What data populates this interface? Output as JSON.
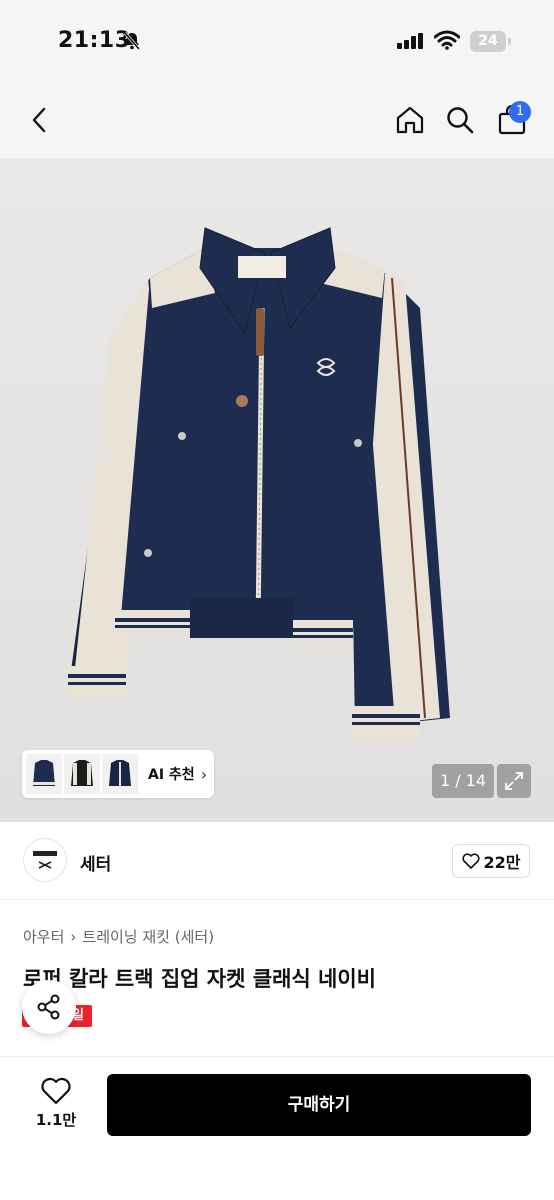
{
  "status_bar": {
    "time": "21:13",
    "battery": "24"
  },
  "nav": {
    "cart_badge": "1",
    "icons": [
      "back-icon",
      "home-icon",
      "search-icon",
      "cart-icon"
    ]
  },
  "gallery": {
    "image_desc_icon": "jacket-photo",
    "ai_reco_label": "AI 추천",
    "page_counter": "1 / 14"
  },
  "shop": {
    "name": "세터",
    "like_count": "22만"
  },
  "breadcrumb": [
    "아우터",
    "트레이닝 재킷 (세터)"
  ],
  "product": {
    "title": "로퍼 칼라 트랙 집업 자켓 클래식 네이비",
    "sale_badge": "세일"
  },
  "bottom": {
    "wish_count": "1.1만",
    "buy_label": "구매하기"
  },
  "colors": {
    "buy_button": "#000000",
    "sale_red": "#e8232b",
    "badge_blue": "#2f6bf3",
    "jacket_navy": "#1e2c4f",
    "jacket_cream": "#e8e3d6"
  }
}
